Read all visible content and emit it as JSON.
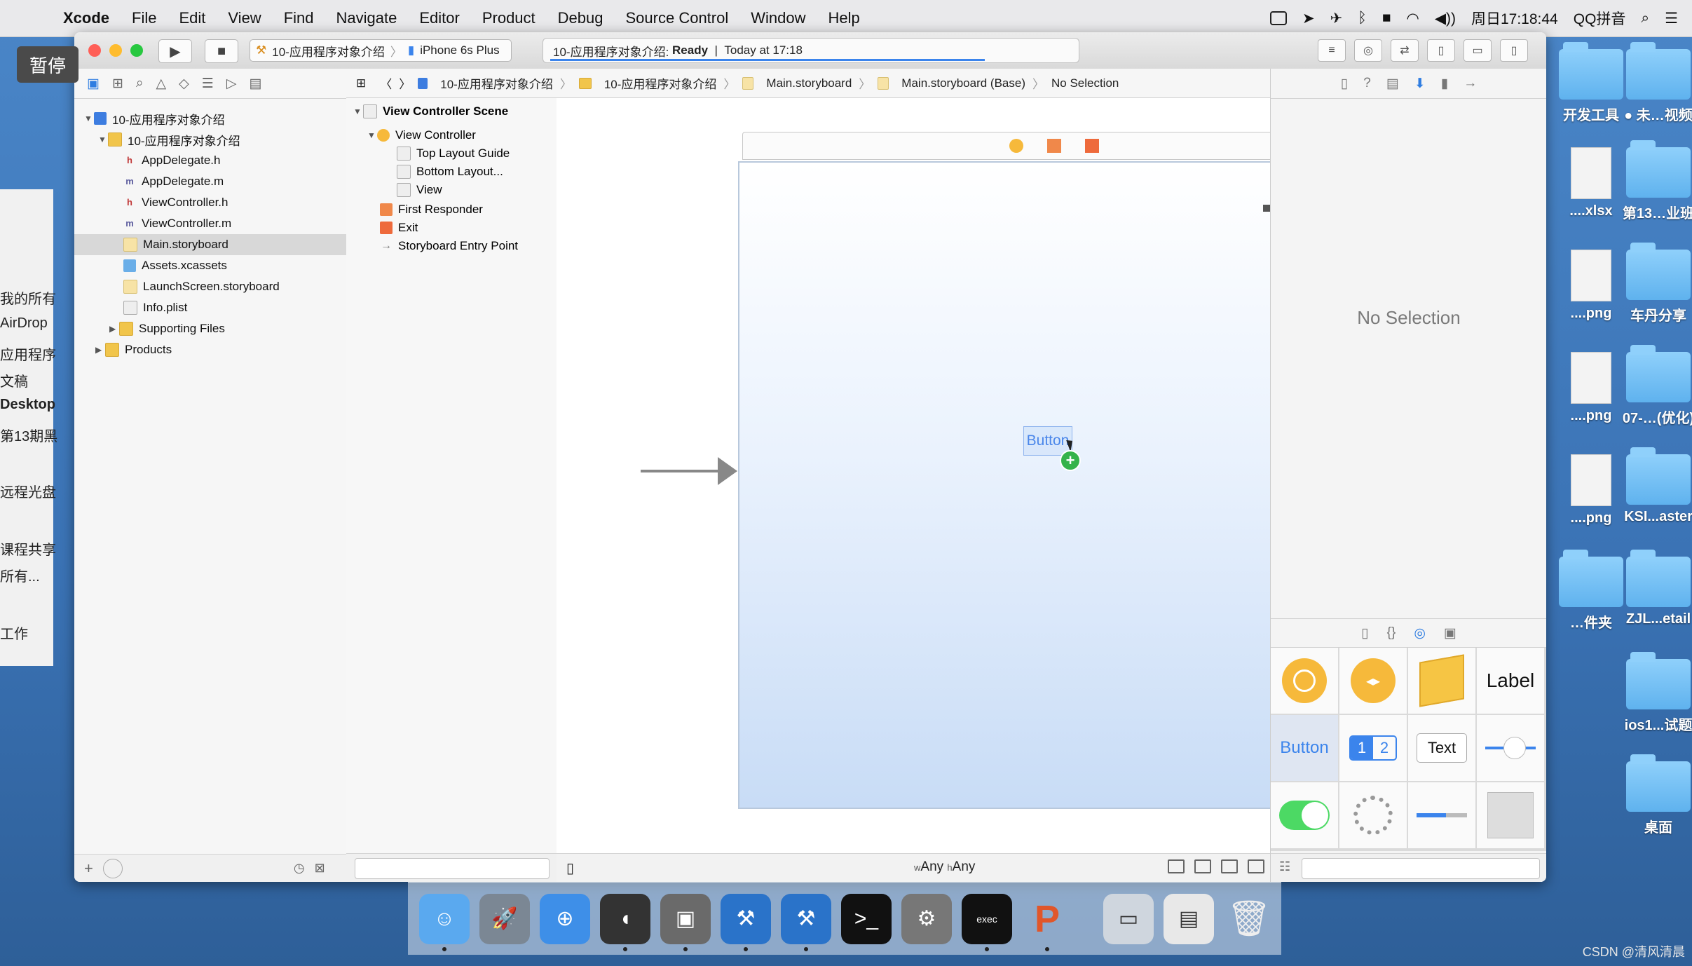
{
  "menubar": {
    "app_name": "Xcode",
    "items": [
      "File",
      "Edit",
      "View",
      "Find",
      "Navigate",
      "Editor",
      "Product",
      "Debug",
      "Source Control",
      "Window",
      "Help"
    ],
    "clock": "周日17:18:44",
    "input_method": "QQ拼音"
  },
  "overlay": {
    "pause_label": "暂停"
  },
  "finder_sidebar": [
    "我的所有",
    "AirDrop",
    "应用程序",
    "文稿",
    "Desktop",
    "第13期黑",
    "远程光盘",
    "课程共享",
    "所有...",
    "工作"
  ],
  "toolbar": {
    "scheme_target": "10-应用程序对象介绍",
    "scheme_device": "iPhone 6s Plus",
    "activity_project": "10-应用程序对象介绍:",
    "activity_status": "Ready",
    "activity_separator": "|",
    "activity_time": "Today at 17:18"
  },
  "navigator": {
    "project": "10-应用程序对象介绍",
    "group": "10-应用程序对象介绍",
    "files": [
      {
        "name": "AppDelegate.h",
        "type": "h"
      },
      {
        "name": "AppDelegate.m",
        "type": "m"
      },
      {
        "name": "ViewController.h",
        "type": "h"
      },
      {
        "name": "ViewController.m",
        "type": "m"
      },
      {
        "name": "Main.storyboard",
        "type": "storyboard"
      },
      {
        "name": "Assets.xcassets",
        "type": "assets"
      },
      {
        "name": "LaunchScreen.storyboard",
        "type": "storyboard"
      },
      {
        "name": "Info.plist",
        "type": "plist"
      }
    ],
    "supporting": "Supporting Files",
    "products": "Products"
  },
  "jumpbar": {
    "crumbs": [
      "10-应用程序对象介绍",
      "10-应用程序对象介绍",
      "Main.storyboard",
      "Main.storyboard (Base)",
      "No Selection"
    ]
  },
  "outline": {
    "scene": "View Controller Scene",
    "controller": "View Controller",
    "children": [
      "Top Layout Guide",
      "Bottom Layout...",
      "View"
    ],
    "first_responder": "First Responder",
    "exit": "Exit",
    "entry_point": "Storyboard Entry Point"
  },
  "canvas": {
    "dragged_button": "Button",
    "size_w_prefix": "w",
    "size_w": "Any",
    "size_h_prefix": "h",
    "size_h": "Any"
  },
  "inspector": {
    "no_selection": "No Selection"
  },
  "library": {
    "label_item": "Label",
    "button_item": "Button",
    "segment_1": "1",
    "segment_2": "2",
    "text_item": "Text",
    "progress_value": 0.58
  },
  "desktop": [
    {
      "label": "开发工具",
      "kind": "folder"
    },
    {
      "label": "● 未…视频",
      "kind": "folder"
    },
    {
      "label": "....xlsx",
      "kind": "doc"
    },
    {
      "label": "第13…业班",
      "kind": "folder"
    },
    {
      "label": "....png",
      "kind": "doc"
    },
    {
      "label": "车丹分享",
      "kind": "folder"
    },
    {
      "label": "....png",
      "kind": "doc"
    },
    {
      "label": "07-…(优化)",
      "kind": "folder"
    },
    {
      "label": "....png",
      "kind": "doc"
    },
    {
      "label": "KSI...aster",
      "kind": "folder"
    },
    {
      "label": "…件夹",
      "kind": "folder"
    },
    {
      "label": "ZJL...etail",
      "kind": "folder"
    },
    {
      "label": "ios1...试题",
      "kind": "folder"
    },
    {
      "label": "桌面",
      "kind": "folder"
    }
  ],
  "watermark": "CSDN @清风清晨",
  "colors": {
    "accent": "#3b84ec",
    "selection": "#d8d8d8",
    "close": "#ff5f57",
    "minimize": "#febc2e",
    "zoom": "#28c840"
  }
}
